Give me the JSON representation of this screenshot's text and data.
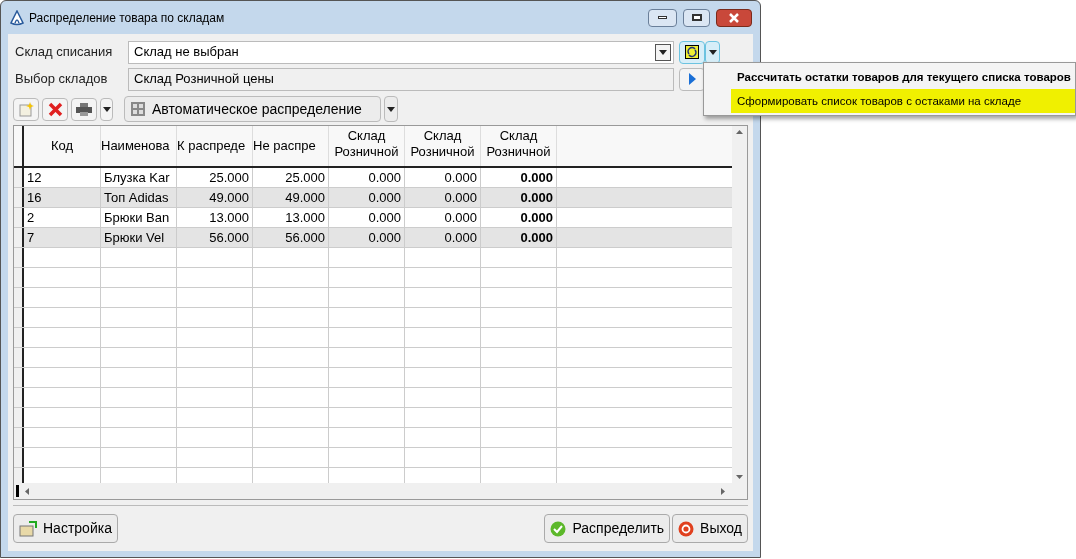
{
  "window": {
    "title": "Распределение товара по складам"
  },
  "fields": [
    {
      "label": "Склад списания",
      "value": "Склад не выбран",
      "kind": "combo"
    },
    {
      "label": "Выбор складов",
      "value": "Склад Розничной цены",
      "kind": "picker"
    }
  ],
  "toolbar": {
    "auto_button": "Автоматическое распределение"
  },
  "menu": [
    {
      "label": "Рассчитать остатки товаров для текущего списка товаров",
      "default": true,
      "selected": false
    },
    {
      "label": "Сформировать список товаров с остаками на складе",
      "default": false,
      "selected": true
    }
  ],
  "table": {
    "columns": [
      "Код",
      "Наименова",
      "К распреде",
      "Не распре",
      "Склад Розничной",
      "Склад Розничной",
      "Склад Розничной"
    ],
    "rows": [
      [
        "12",
        "Блузка Kar",
        "25.000",
        "25.000",
        "0.000",
        "0.000",
        "0.000"
      ],
      [
        "16",
        "Топ Adidas",
        "49.000",
        "49.000",
        "0.000",
        "0.000",
        "0.000"
      ],
      [
        "2",
        "Брюки Ban",
        "13.000",
        "13.000",
        "0.000",
        "0.000",
        "0.000"
      ],
      [
        "7",
        "Брюки Vel",
        "56.000",
        "56.000",
        "0.000",
        "0.000",
        "0.000"
      ]
    ]
  },
  "buttons": {
    "settings": "Настройка",
    "distribute": "Распределить",
    "exit": "Выход"
  }
}
